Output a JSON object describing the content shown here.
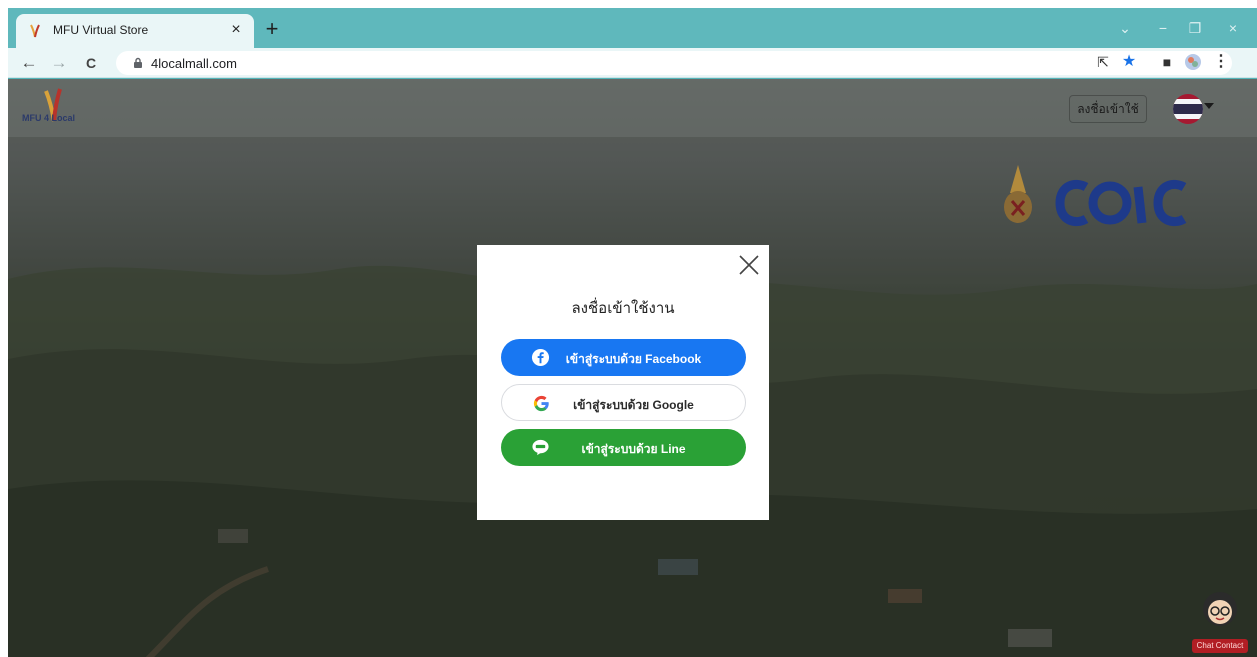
{
  "browser": {
    "tab_title": "MFU Virtual Store",
    "tab_close": "×",
    "new_tab": "+",
    "url": "4localmall.com",
    "window_controls": {
      "dropdown": "⌄",
      "minimize": "−",
      "restore": "❐",
      "close": "×"
    },
    "nav": {
      "back": "←",
      "forward": "→",
      "reload": "C"
    },
    "toolbar_icons": {
      "share": "⇱",
      "star": "★",
      "sidepanel": "■",
      "menu": "⋮"
    }
  },
  "site": {
    "logo_text": "MFU 4 Local",
    "login_label": "ลงชื่อเข้าใช้",
    "language": "th",
    "chat_label": "Chat Contact"
  },
  "modal": {
    "title": "ลงชื่อเข้าใช้งาน",
    "facebook_label": "เข้าสู่ระบบด้วย Facebook",
    "google_label": "เข้าสู่ระบบด้วย Google",
    "line_label": "เข้าสู่ระบบด้วย Line"
  },
  "colors": {
    "browser_frame": "#5fb8bc",
    "facebook": "#1877f2",
    "line": "#2aa136",
    "brand_blue": "#1e3a8a"
  }
}
